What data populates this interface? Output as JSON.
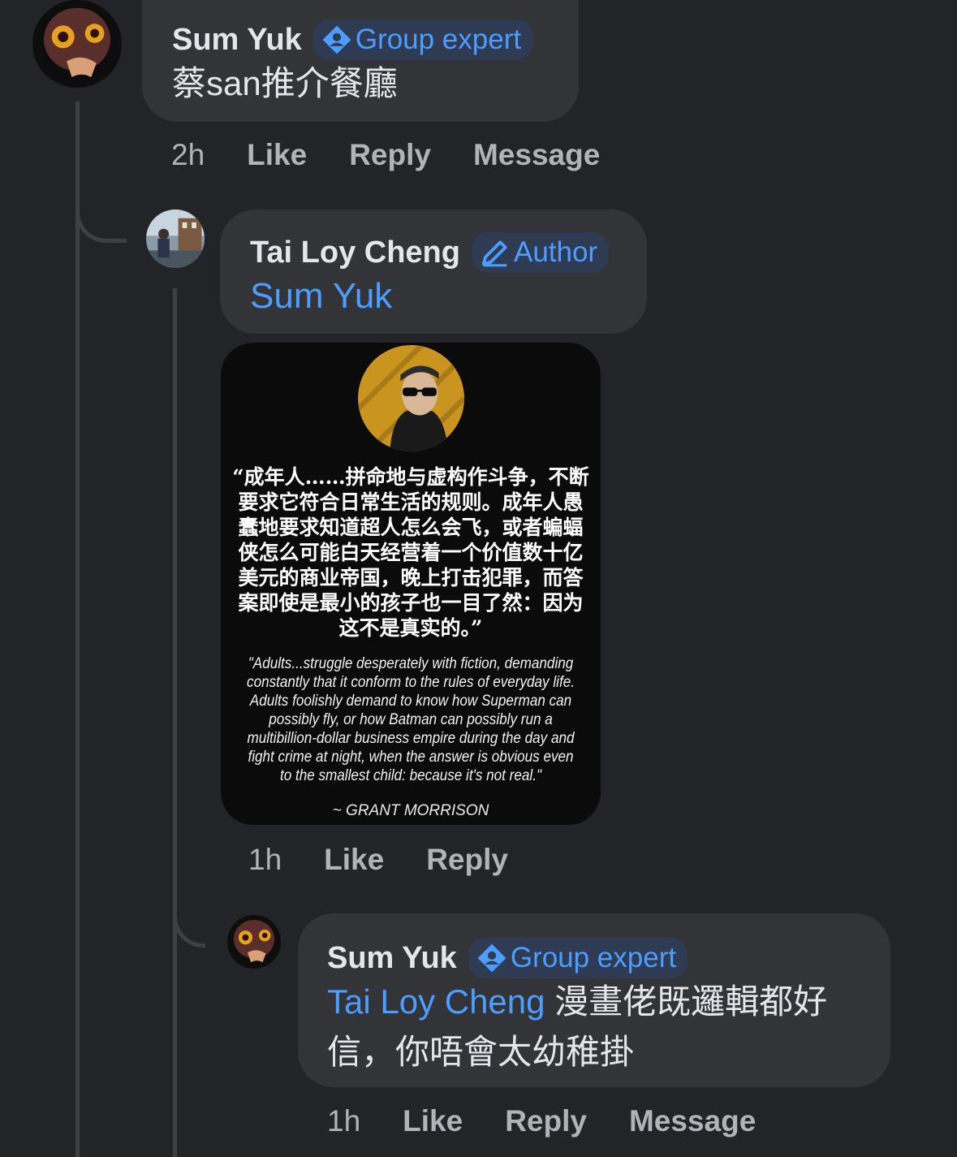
{
  "comments": [
    {
      "author": "Sum Yuk",
      "badge": "Group expert",
      "text": "蔡san推介餐廳",
      "time": "2h",
      "like": "Like",
      "reply": "Reply",
      "message": "Message"
    },
    {
      "author": "Tai Loy Cheng",
      "badge": "Author",
      "mention": "Sum Yuk",
      "time": "1h",
      "like": "Like",
      "reply": "Reply",
      "image": {
        "quote_cn": "“成年人……拼命地与虚构作斗争，不断要求它符合日常生活的规则。成年人愚蠢地要求知道超人怎么会飞，或者蝙蝠侠怎么可能白天经营着一个价值数十亿美元的商业帝国，晚上打击犯罪，而答案即使是最小的孩子也一目了然：因为这不是真实的。”",
        "quote_en": "\"Adults...struggle desperately with fiction, demanding constantly that it conform to the rules of everyday life. Adults foolishly demand to know how Superman can possibly fly, or how Batman can possibly run a multibillion-dollar business empire during the day and fight crime at night, when the answer is obvious even to the smallest child: because it's not real.\"",
        "attribution": "~ GRANT MORRISON"
      }
    },
    {
      "author": "Sum Yuk",
      "badge": "Group expert",
      "mention": "Tai Loy Cheng",
      "text": " 漫畫佬既邏輯都好信，你唔會太幼稚掛",
      "time": "1h",
      "like": "Like",
      "reply": "Reply",
      "message": "Message"
    }
  ],
  "colors": {
    "background": "#232427",
    "bubble": "#333438",
    "accent": "#4c9dff",
    "muted": "#b0b3b8"
  },
  "icons": {
    "group_expert": "expert-badge-icon",
    "author": "pencil-icon"
  }
}
